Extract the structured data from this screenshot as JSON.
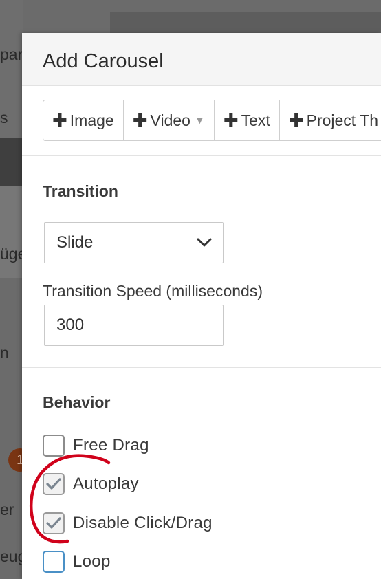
{
  "background": {
    "fragments": [
      "par",
      "s",
      "üge",
      "n",
      "er",
      "eug"
    ],
    "badge": "1"
  },
  "modal": {
    "title": "Add Carousel"
  },
  "toolbar": {
    "buttons": [
      {
        "label": "Image",
        "icon": "plus-icon"
      },
      {
        "label": "Video",
        "icon": "plus-icon",
        "dropdown": true
      },
      {
        "label": "Text",
        "icon": "plus-icon"
      },
      {
        "label": "Project Th",
        "icon": "plus-icon"
      }
    ]
  },
  "transition": {
    "heading": "Transition",
    "selected": "Slide",
    "speed_label": "Transition Speed (milliseconds)",
    "speed_value": "300"
  },
  "behavior": {
    "heading": "Behavior",
    "options": [
      {
        "label": "Free Drag",
        "checked": false
      },
      {
        "label": "Autoplay",
        "checked": true
      },
      {
        "label": "Disable Click/Drag",
        "checked": true
      },
      {
        "label": "Loop",
        "checked": false
      }
    ]
  },
  "colors": {
    "annotation": "#d0021b",
    "focus_border": "#4a90c6"
  }
}
